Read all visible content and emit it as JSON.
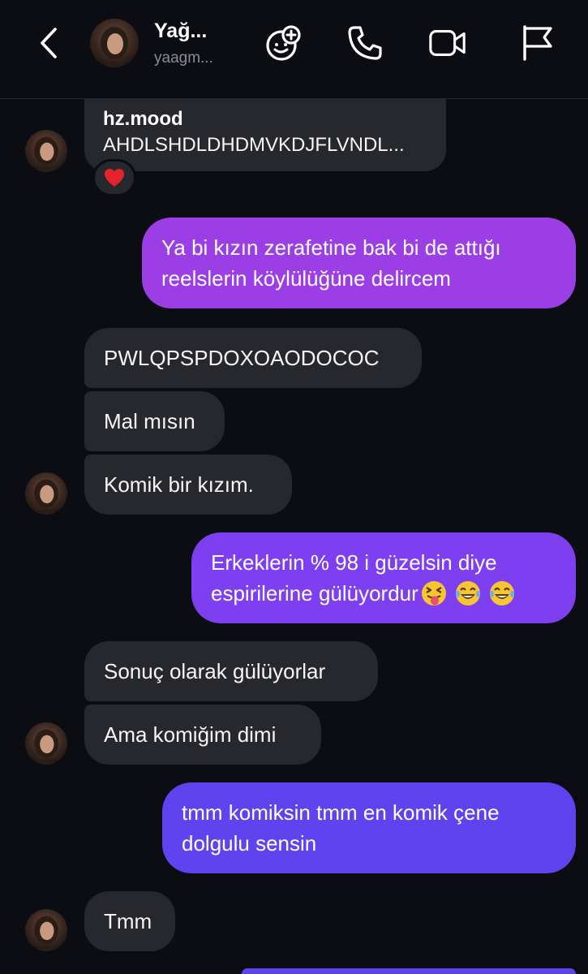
{
  "header": {
    "name": "Yağ...",
    "username": "yaagm..."
  },
  "reply": {
    "user": "hz.mood",
    "text": "AHDLSHDLDHDMVKDJFLVNDL..."
  },
  "reaction": "heart",
  "messages": {
    "m1_line1": "Ya bi kızın zerafetine bak bi de attığı",
    "m1_line2": "reelslerin köylülüğüne delircem",
    "m2": "PWLQPSPDOXOAODOCOC",
    "m3": "Mal mısın",
    "m4": "Komik bir kızım.",
    "m5_line1": "Erkeklerin % 98 i güzelsin diye",
    "m5_line2": "espirilerine gülüyordur",
    "m5_emojis": [
      "face-with-tongue-squinting",
      "tears-of-joy",
      "tears-of-joy"
    ],
    "m6": "Sonuç olarak gülüyorlar",
    "m7": "Ama komiğim dimi",
    "m8_line1": "tmm komiksin tmm en komik çene",
    "m8_line2": "dolgulu sensin",
    "m9": "Tmm"
  },
  "colors": {
    "background": "#0b0d12",
    "incoming_bubble": "#26282e",
    "outgoing_purple_1": "#9b3ee6",
    "outgoing_purple_2": "#7d3ff0",
    "outgoing_purple_3": "#5f43ee",
    "heart": "#e5232d"
  },
  "icons": [
    "back-chevron-icon",
    "sticker-add-icon",
    "phone-icon",
    "video-camera-icon",
    "flag-icon",
    "heart-icon"
  ]
}
